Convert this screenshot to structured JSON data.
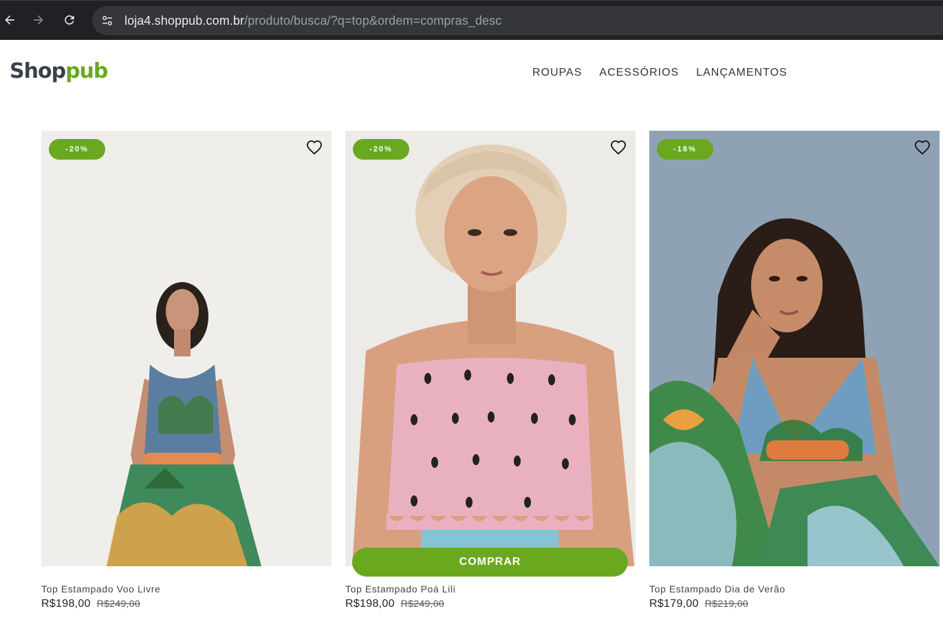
{
  "browser": {
    "url_host": "loja4.shoppub.com.br",
    "url_path": "/produto/busca/?q=top&ordem=compras_desc",
    "back_icon": "arrow-left-icon",
    "forward_icon": "arrow-right-icon",
    "reload_icon": "reload-icon",
    "site_info_icon": "tune-icon"
  },
  "header": {
    "logo_part1": "Shop",
    "logo_part2": "pub",
    "menu": [
      "ROUPAS",
      "ACESSÓRIOS",
      "LANÇAMENTOS"
    ]
  },
  "colors": {
    "brand_green": "#6aa820",
    "logo_dark": "#3a3f4b"
  },
  "products": [
    {
      "discount": "-20%",
      "name": "Top Estampado Voo Livre",
      "price": "R$198,00",
      "old_price": "R$249,00",
      "icon": "heart-icon"
    },
    {
      "discount": "-20%",
      "name": "Top Estampado Poá Lili",
      "price": "R$198,00",
      "old_price": "R$249,00",
      "buy_label": "COMPRAR",
      "icon": "heart-icon"
    },
    {
      "discount": "-18%",
      "name": "Top Estampado Dia de Verão",
      "price": "R$179,00",
      "old_price": "R$219,00",
      "icon": "heart-icon"
    }
  ]
}
